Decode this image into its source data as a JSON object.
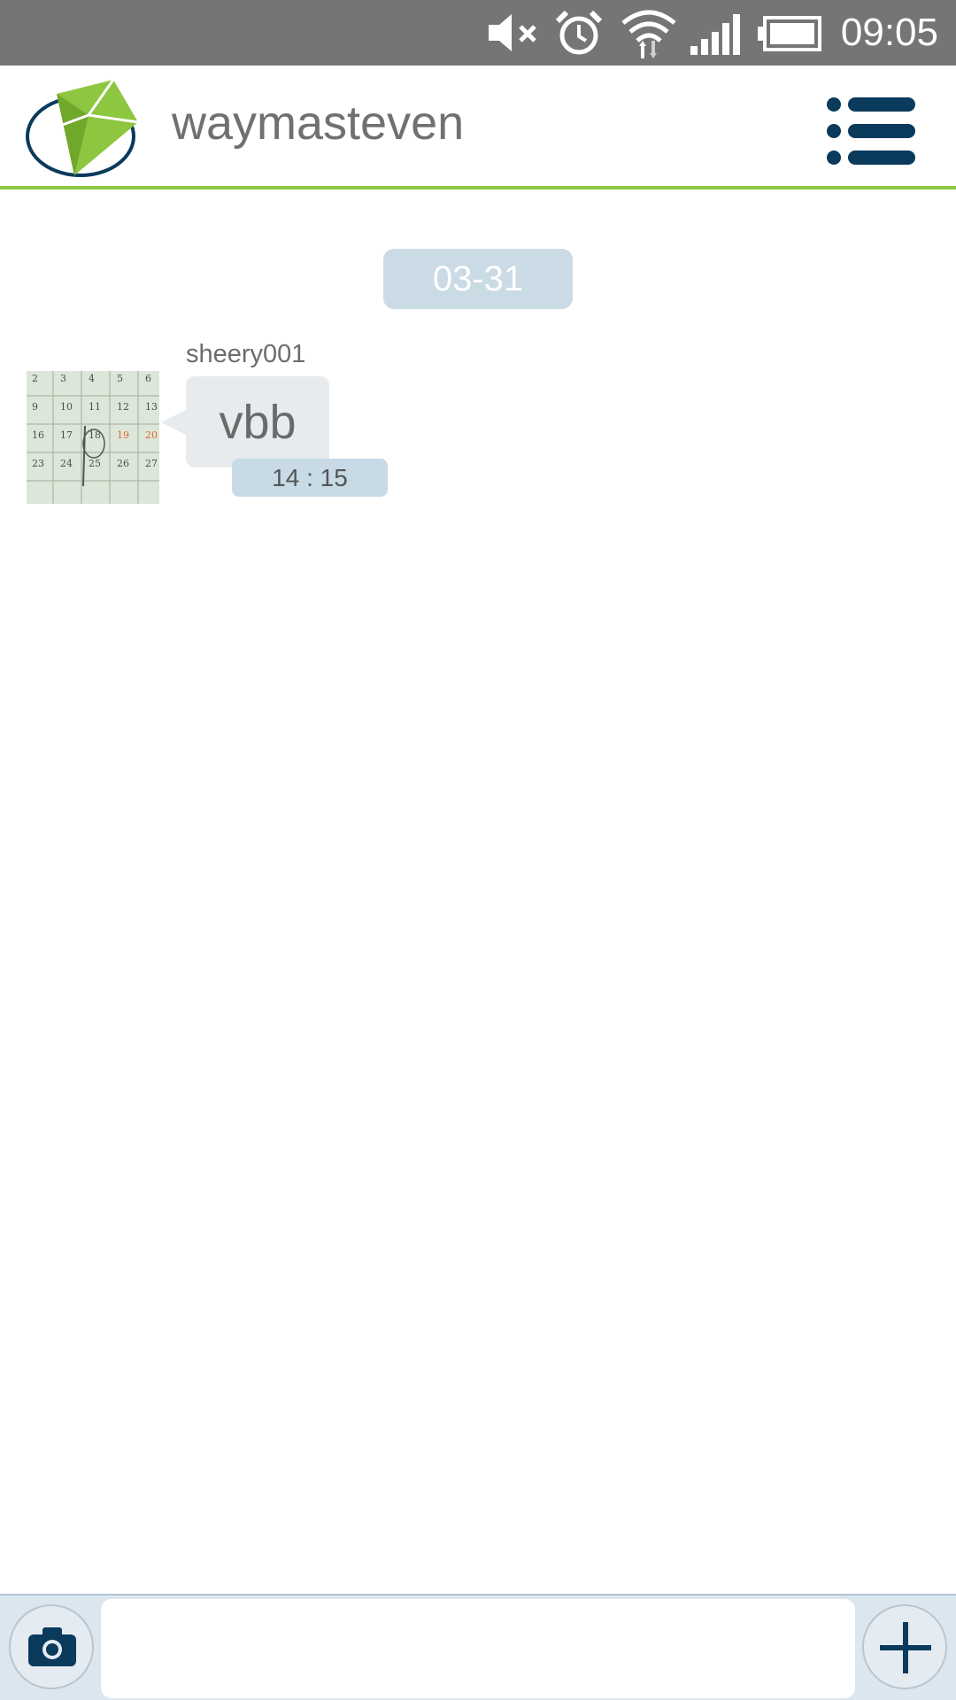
{
  "status_bar": {
    "time": "09:05",
    "icons": [
      "mute-icon",
      "alarm-icon",
      "wifi-icon",
      "signal-icon",
      "battery-icon"
    ]
  },
  "header": {
    "title": "waymasteven",
    "menu_icon": "menu-list-icon",
    "accent_color": "#8dc63f",
    "brand_dark": "#0a3a5c"
  },
  "chat": {
    "date_label": "03-31",
    "messages": [
      {
        "sender": "sheery001",
        "text": "vbb",
        "time": "14 : 15",
        "avatar_calendar_numbers": [
          [
            "2",
            "3",
            "4",
            "5",
            "6"
          ],
          [
            "9",
            "10",
            "11",
            "12",
            "13"
          ],
          [
            "16",
            "17",
            "18",
            "19",
            "20"
          ],
          [
            "23",
            "24",
            "25",
            "26",
            "27"
          ]
        ]
      }
    ]
  },
  "composer": {
    "camera_icon": "camera-icon",
    "input_value": "",
    "input_placeholder": "",
    "plus_icon": "plus-icon"
  }
}
